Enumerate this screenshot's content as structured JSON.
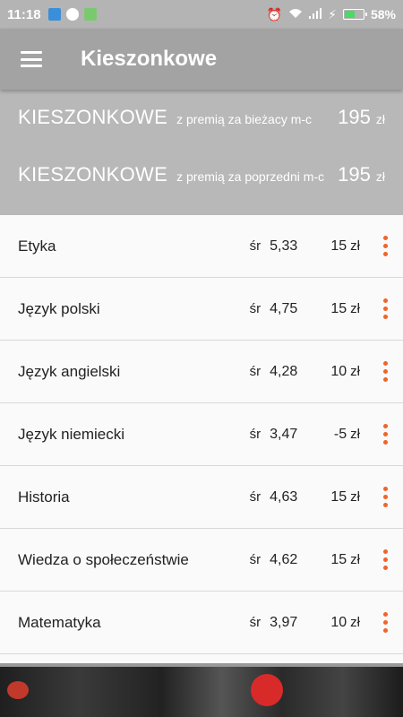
{
  "status_bar": {
    "time": "11:18",
    "battery": "58%",
    "battery_level": 0.58,
    "icons_left": [
      "shield-icon",
      "messenger-icon",
      "android-icon"
    ],
    "icons_right": [
      "alarm-icon",
      "wifi-icon",
      "signal-icon",
      "charging-icon",
      "battery-icon"
    ]
  },
  "app_bar": {
    "title": "Kieszonkowe",
    "menu_icon": "menu-icon"
  },
  "summary": [
    {
      "label": "KIESZONKOWE",
      "sub": "z premią za bieżacy m-c",
      "amount": "195",
      "unit": "zł"
    },
    {
      "label": "KIESZONKOWE",
      "sub": "z premią za poprzedni m-c",
      "amount": "195",
      "unit": "zł"
    }
  ],
  "subjects": [
    {
      "name": "Etyka",
      "sr": "śr",
      "avg": "5,33",
      "amount": "15",
      "unit": "zł"
    },
    {
      "name": "Język polski",
      "sr": "śr",
      "avg": "4,75",
      "amount": "15",
      "unit": "zł"
    },
    {
      "name": "Język angielski",
      "sr": "śr",
      "avg": "4,28",
      "amount": "10",
      "unit": "zł"
    },
    {
      "name": "Język niemiecki",
      "sr": "śr",
      "avg": "3,47",
      "amount": "-5",
      "unit": "zł"
    },
    {
      "name": "Historia",
      "sr": "śr",
      "avg": "4,63",
      "amount": "15",
      "unit": "zł"
    },
    {
      "name": "Wiedza o społeczeństwie",
      "sr": "śr",
      "avg": "4,62",
      "amount": "15",
      "unit": "zł"
    },
    {
      "name": "Matematyka",
      "sr": "śr",
      "avg": "3,97",
      "amount": "10",
      "unit": "zł"
    }
  ],
  "colors": {
    "accent": "#f0632a",
    "app_bar": "#a3a3a3",
    "summary_bg": "#b8b8b8"
  }
}
